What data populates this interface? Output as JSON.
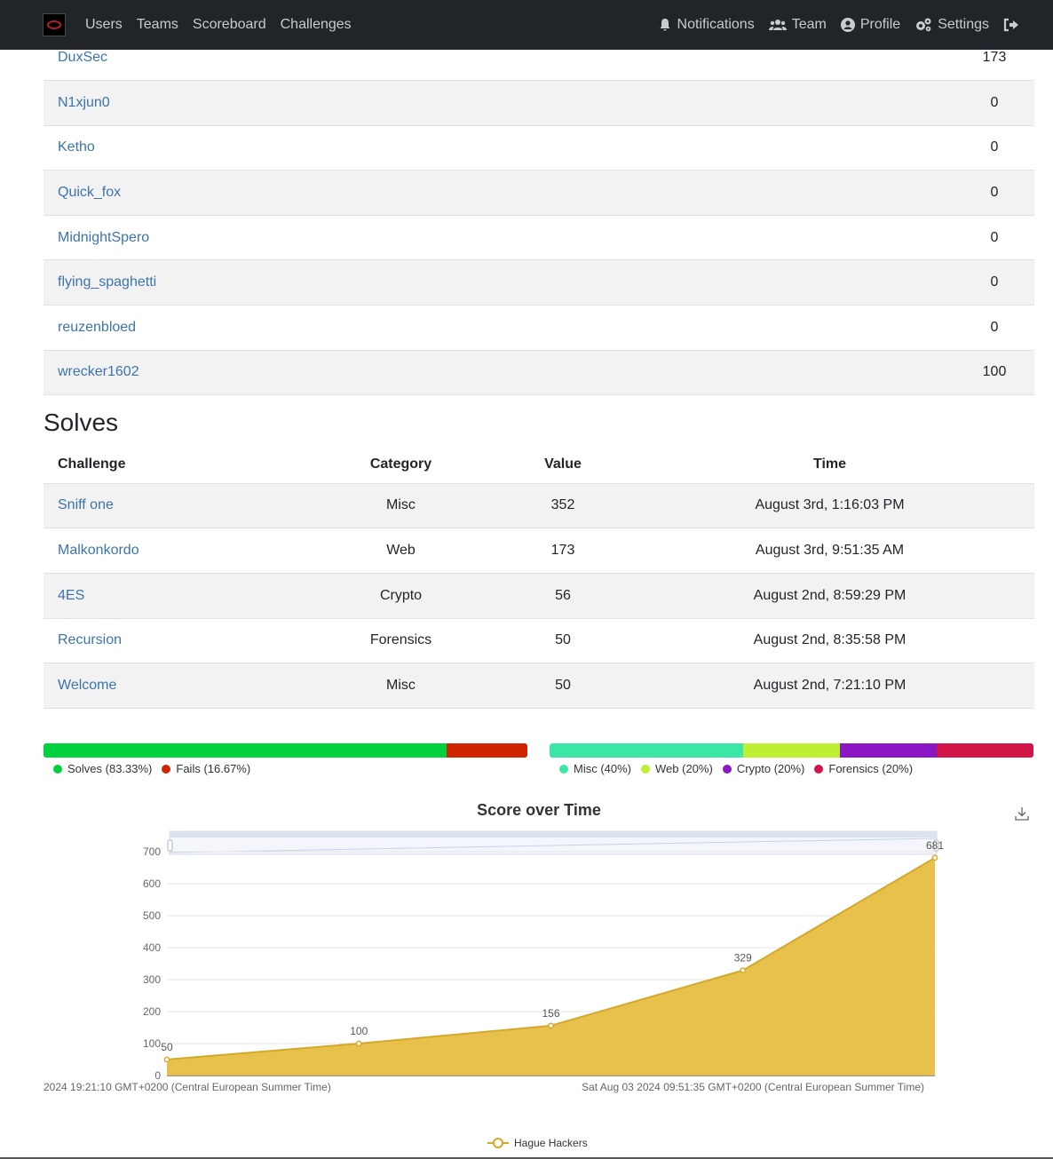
{
  "nav": {
    "left": [
      "Users",
      "Teams",
      "Scoreboard",
      "Challenges"
    ],
    "right": [
      {
        "label": "Notifications",
        "icon": "bell-icon"
      },
      {
        "label": "Team",
        "icon": "users-icon"
      },
      {
        "label": "Profile",
        "icon": "user-circle-icon"
      },
      {
        "label": "Settings",
        "icon": "cogs-icon"
      }
    ],
    "logout_icon": "logout-icon"
  },
  "members": [
    {
      "name": "DuxSec",
      "score": "173"
    },
    {
      "name": "N1xjun0",
      "score": "0"
    },
    {
      "name": "Ketho",
      "score": "0"
    },
    {
      "name": "Quick_fox",
      "score": "0"
    },
    {
      "name": "MidnightSpero",
      "score": "0"
    },
    {
      "name": "flying_spaghetti",
      "score": "0"
    },
    {
      "name": "reuzenbloed",
      "score": "0"
    },
    {
      "name": "wrecker1602",
      "score": "100"
    }
  ],
  "solves": {
    "title": "Solves",
    "headers": [
      "Challenge",
      "Category",
      "Value",
      "Time"
    ],
    "rows": [
      {
        "challenge": "Sniff one",
        "category": "Misc",
        "value": "352",
        "time": "August 3rd, 1:16:03 PM"
      },
      {
        "challenge": "Malkonkordo",
        "category": "Web",
        "value": "173",
        "time": "August 3rd, 9:51:35 AM"
      },
      {
        "challenge": "4ES",
        "category": "Crypto",
        "value": "56",
        "time": "August 2nd, 8:59:29 PM"
      },
      {
        "challenge": "Recursion",
        "category": "Forensics",
        "value": "50",
        "time": "August 2nd, 8:35:58 PM"
      },
      {
        "challenge": "Welcome",
        "category": "Misc",
        "value": "50",
        "time": "August 2nd, 7:21:10 PM"
      }
    ]
  },
  "solve_fail": [
    {
      "label": "Solves (83.33%)",
      "fraction": 0.8333,
      "color": "#00d13f"
    },
    {
      "label": "Fails (16.67%)",
      "fraction": 0.1667,
      "color": "#cf2600"
    }
  ],
  "categories": [
    {
      "label": "Misc (40%)",
      "fraction": 0.4,
      "color": "#3ce6a4"
    },
    {
      "label": "Web (20%)",
      "fraction": 0.2,
      "color": "#bdf032"
    },
    {
      "label": "Crypto (20%)",
      "fraction": 0.2,
      "color": "#8a16c4"
    },
    {
      "label": "Forensics (20%)",
      "fraction": 0.2,
      "color": "#d11549"
    }
  ],
  "chart_data": {
    "type": "area",
    "title": "Score over Time",
    "x": [
      "2024 19:21:10 GMT+0200 (Central European Summer Time)",
      "",
      "",
      "Sat Aug 03 2024 09:51:35 GMT+0200 (Central European Summer Time)",
      ""
    ],
    "series": [
      {
        "name": "Hague Hackers",
        "values": [
          50,
          100,
          156,
          329,
          681
        ],
        "color": "#e6b938"
      }
    ],
    "data_labels": [
      "50",
      "100",
      "156",
      "329",
      "681"
    ],
    "ylim": [
      0,
      700
    ],
    "yticks": [
      "0",
      "100",
      "200",
      "300",
      "400",
      "500",
      "600",
      "700"
    ],
    "grid": true,
    "legend": "bottom-center",
    "download_icon": "download-icon"
  }
}
